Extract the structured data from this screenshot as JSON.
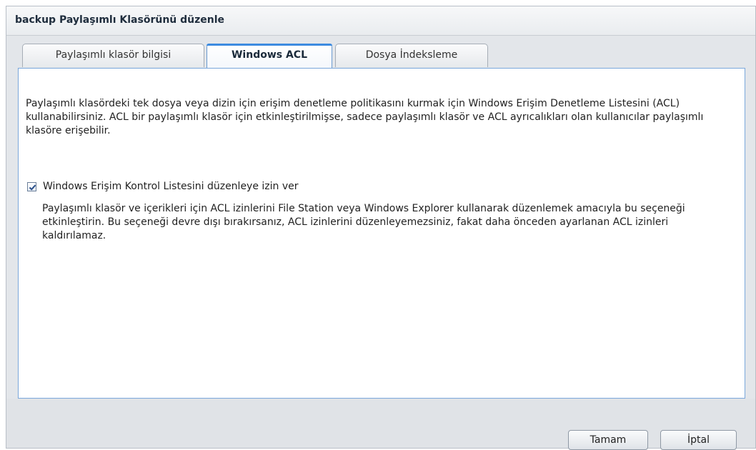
{
  "dialog": {
    "title": "backup Paylaşımlı Klasörünü düzenle"
  },
  "tabs": [
    {
      "label": "Paylaşımlı klasör bilgisi",
      "active": false
    },
    {
      "label": "Windows ACL",
      "active": true
    },
    {
      "label": "Dosya İndeksleme",
      "active": false
    }
  ],
  "content": {
    "description": "Paylaşımlı klasördeki tek dosya veya dizin için erişim denetleme politikasını kurmak için Windows Erişim Denetleme Listesini (ACL) kullanabilirsiniz. ACL bir paylaşımlı klasör için etkinleştirilmişse, sadece paylaşımlı klasör ve ACL ayrıcalıkları olan kullanıcılar paylaşımlı klasöre erişebilir.",
    "checkbox_label": "Windows Erişim Kontrol Listesini düzenleye izin ver",
    "checkbox_checked": true,
    "checkbox_help": "Paylaşımlı klasör ve içerikleri için ACL izinlerini File Station veya Windows Explorer kullanarak düzenlemek amacıyla bu seçeneği etkinleştirin. Bu seçeneği devre dışı bırakırsanız, ACL izinlerini düzenleyemezsiniz, fakat daha önceden ayarlanan ACL izinleri kaldırılamaz."
  },
  "footer": {
    "ok_label": "Tamam",
    "cancel_label": "İptal"
  },
  "colors": {
    "active_tab_accent": "#3c8be0",
    "content_border": "#7aa7db",
    "checkbox_check": "#2a4f8a"
  }
}
